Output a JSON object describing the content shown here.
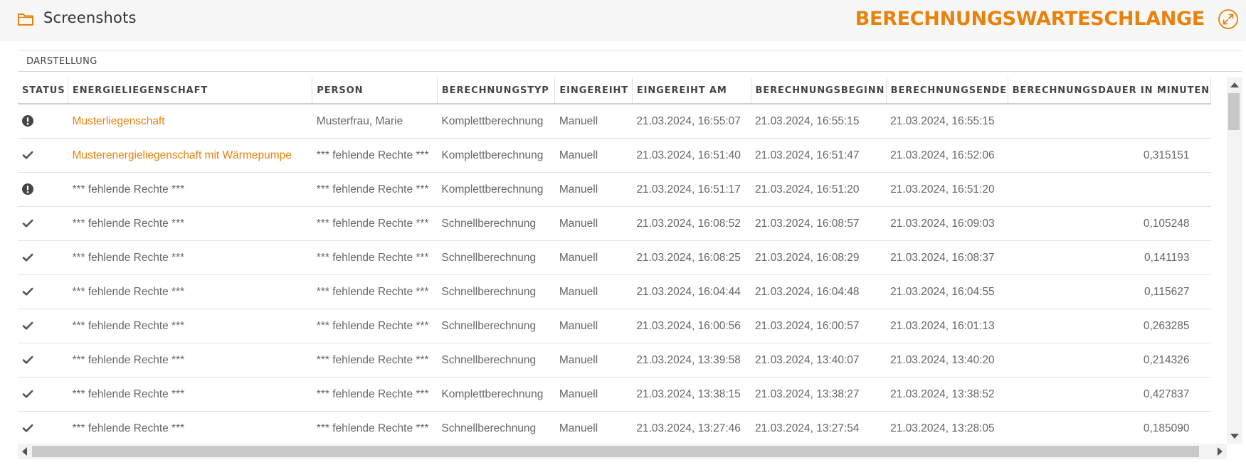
{
  "header": {
    "app_title": "Screenshots",
    "page_title": "BERECHNUNGSWARTESCHLANGE",
    "accent_color": "#e8820c",
    "folder_icon": "folder-icon",
    "expand_icon": "expand-icon"
  },
  "panel": {
    "label": "DARSTELLUNG"
  },
  "table": {
    "columns": [
      "STATUS",
      "ENERGIELIEGENSCHAFT",
      "PERSON",
      "BERECHNUNGSTYP",
      "EINGEREIHT",
      "EINGEREIHT AM",
      "BERECHNUNGSBEGINN",
      "BERECHNUNGSENDE",
      "BERECHNUNGSDAUER IN MINUTEN"
    ],
    "rows": [
      {
        "status": "error",
        "liegenschaft": "Musterliegenschaft",
        "linked": true,
        "person": "Musterfrau, Marie",
        "typ": "Komplettberechnung",
        "eingereiht": "Manuell",
        "am": "21.03.2024, 16:55:07",
        "beginn": "21.03.2024, 16:55:15",
        "ende": "21.03.2024, 16:55:15",
        "dauer": ""
      },
      {
        "status": "done",
        "liegenschaft": "Musterenergieliegenschaft mit Wärmepumpe",
        "linked": true,
        "person": "*** fehlende Rechte ***",
        "typ": "Komplettberechnung",
        "eingereiht": "Manuell",
        "am": "21.03.2024, 16:51:40",
        "beginn": "21.03.2024, 16:51:47",
        "ende": "21.03.2024, 16:52:06",
        "dauer": "0,315151"
      },
      {
        "status": "error",
        "liegenschaft": "*** fehlende Rechte ***",
        "linked": false,
        "person": "*** fehlende Rechte ***",
        "typ": "Komplettberechnung",
        "eingereiht": "Manuell",
        "am": "21.03.2024, 16:51:17",
        "beginn": "21.03.2024, 16:51:20",
        "ende": "21.03.2024, 16:51:20",
        "dauer": ""
      },
      {
        "status": "done",
        "liegenschaft": "*** fehlende Rechte ***",
        "linked": false,
        "person": "*** fehlende Rechte ***",
        "typ": "Schnellberechnung",
        "eingereiht": "Manuell",
        "am": "21.03.2024, 16:08:52",
        "beginn": "21.03.2024, 16:08:57",
        "ende": "21.03.2024, 16:09:03",
        "dauer": "0,105248"
      },
      {
        "status": "done",
        "liegenschaft": "*** fehlende Rechte ***",
        "linked": false,
        "person": "*** fehlende Rechte ***",
        "typ": "Schnellberechnung",
        "eingereiht": "Manuell",
        "am": "21.03.2024, 16:08:25",
        "beginn": "21.03.2024, 16:08:29",
        "ende": "21.03.2024, 16:08:37",
        "dauer": "0,141193"
      },
      {
        "status": "done",
        "liegenschaft": "*** fehlende Rechte ***",
        "linked": false,
        "person": "*** fehlende Rechte ***",
        "typ": "Schnellberechnung",
        "eingereiht": "Manuell",
        "am": "21.03.2024, 16:04:44",
        "beginn": "21.03.2024, 16:04:48",
        "ende": "21.03.2024, 16:04:55",
        "dauer": "0,115627"
      },
      {
        "status": "done",
        "liegenschaft": "*** fehlende Rechte ***",
        "linked": false,
        "person": "*** fehlende Rechte ***",
        "typ": "Schnellberechnung",
        "eingereiht": "Manuell",
        "am": "21.03.2024, 16:00:56",
        "beginn": "21.03.2024, 16:00:57",
        "ende": "21.03.2024, 16:01:13",
        "dauer": "0,263285"
      },
      {
        "status": "done",
        "liegenschaft": "*** fehlende Rechte ***",
        "linked": false,
        "person": "*** fehlende Rechte ***",
        "typ": "Schnellberechnung",
        "eingereiht": "Manuell",
        "am": "21.03.2024, 13:39:58",
        "beginn": "21.03.2024, 13:40:07",
        "ende": "21.03.2024, 13:40:20",
        "dauer": "0,214326"
      },
      {
        "status": "done",
        "liegenschaft": "*** fehlende Rechte ***",
        "linked": false,
        "person": "*** fehlende Rechte ***",
        "typ": "Komplettberechnung",
        "eingereiht": "Manuell",
        "am": "21.03.2024, 13:38:15",
        "beginn": "21.03.2024, 13:38:27",
        "ende": "21.03.2024, 13:38:52",
        "dauer": "0,427837"
      },
      {
        "status": "done",
        "liegenschaft": "*** fehlende Rechte ***",
        "linked": false,
        "person": "*** fehlende Rechte ***",
        "typ": "Schnellberechnung",
        "eingereiht": "Manuell",
        "am": "21.03.2024, 13:27:46",
        "beginn": "21.03.2024, 13:27:54",
        "ende": "21.03.2024, 13:28:05",
        "dauer": "0,185090"
      }
    ]
  }
}
